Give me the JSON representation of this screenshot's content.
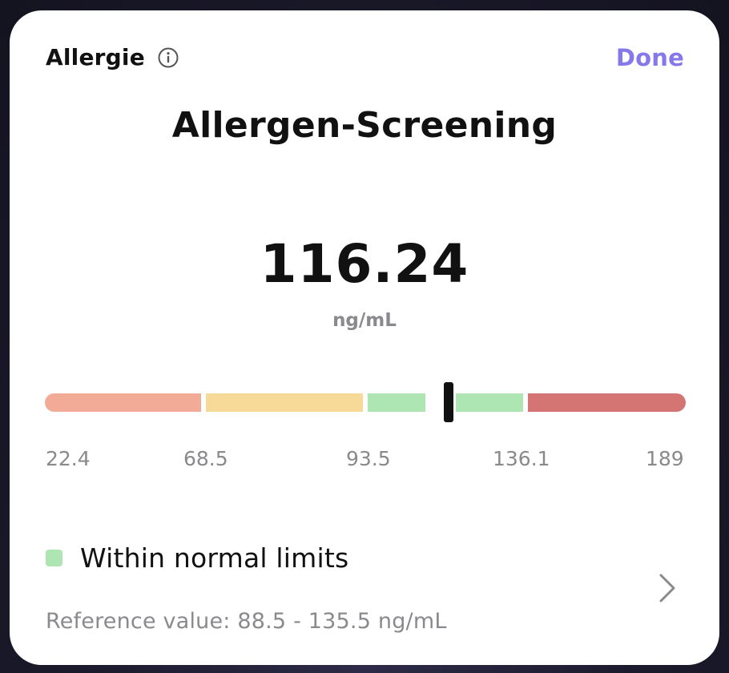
{
  "header": {
    "category": "Allergie",
    "info_icon": "info-circle-icon",
    "done_label": "Done",
    "done_color": "#8478ea"
  },
  "test": {
    "title": "Allergen-Screening",
    "value": "116.24",
    "value_number": 116.24,
    "unit": "ng/mL"
  },
  "scale": {
    "min": 22.4,
    "max": 189,
    "ticks": [
      "22.4",
      "68.5",
      "93.5",
      "136.1",
      "189"
    ],
    "segments": [
      {
        "color": "#f2ab96"
      },
      {
        "color": "#f7da97"
      },
      {
        "color": "#ade6b2"
      },
      {
        "color": "#ade6b2"
      },
      {
        "color": "#d47574"
      }
    ]
  },
  "status": {
    "label": "Within normal limits",
    "color": "#ade6b2"
  },
  "reference": {
    "text": "Reference value: 88.5 - 135.5 ng/mL"
  },
  "detail_icon": "chevron-right-icon"
}
